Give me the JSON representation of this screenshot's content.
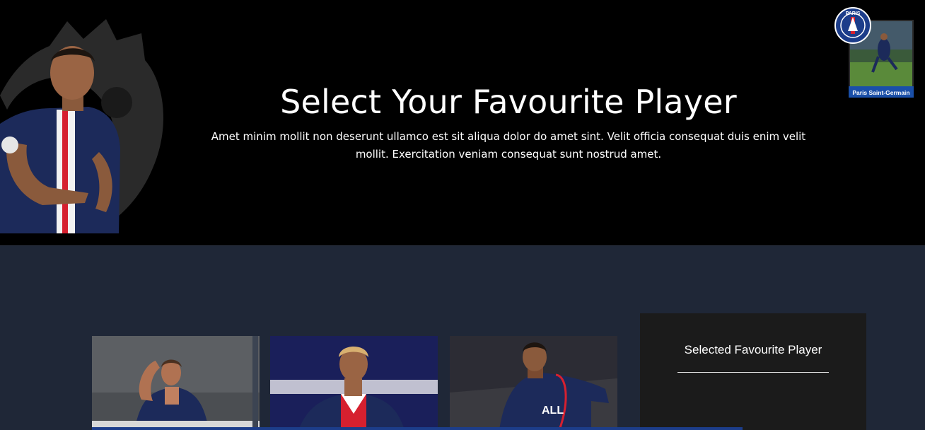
{
  "hero": {
    "title": "Select Your Favourite Player",
    "description": "Amet minim mollit non deserunt ullamco est sit aliqua dolor do amet sint. Velit officia consequat duis enim velit mollit. Exercitation veniam consequat sunt nostrud amet."
  },
  "club": {
    "badge_top": "PARIS",
    "caption": "Paris Saint-Germain"
  },
  "players": [
    {
      "photo": "player-photo-1"
    },
    {
      "photo": "player-photo-2"
    },
    {
      "photo": "player-photo-3"
    }
  ],
  "selected_panel": {
    "title": "Selected Favourite Player"
  },
  "colors": {
    "hero_bg": "#000000",
    "page_bg": "#1f2737",
    "panel_bg": "#1b1b1b",
    "psg_navy": "#1c2a5a",
    "psg_red": "#d6202f"
  }
}
